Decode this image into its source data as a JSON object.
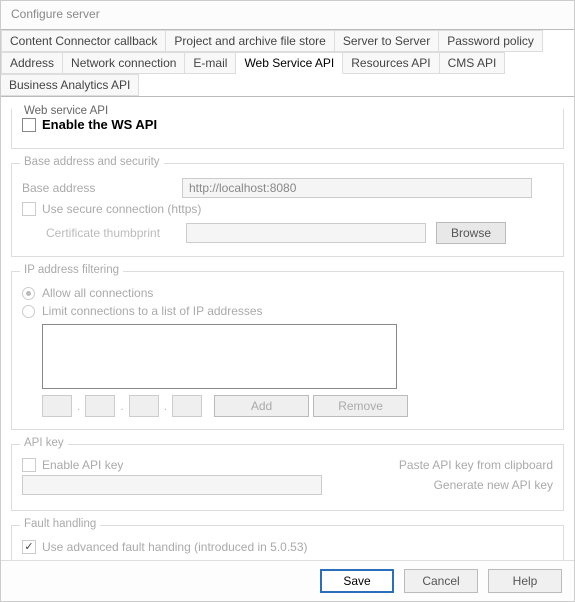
{
  "window_title": "Configure server",
  "tabs_row1": [
    "Content Connector callback",
    "Project and archive file store",
    "Server to Server",
    "Password policy"
  ],
  "tabs_row2": [
    "Address",
    "Network connection",
    "E-mail",
    "Web Service API",
    "Resources API",
    "CMS API",
    "Business Analytics API"
  ],
  "active_tab": "Web Service API",
  "groups": {
    "top_legend": "Web service API",
    "enable_ws_label": "Enable the WS API",
    "base": {
      "legend": "Base address and security",
      "base_address_label": "Base address",
      "base_address_value": "http://localhost:8080",
      "secure_conn_label": "Use secure connection (https)",
      "cert_label": "Certificate thumbprint",
      "browse_btn": "Browse"
    },
    "ipfilter": {
      "legend": "IP address filtering",
      "allow_all": "Allow all connections",
      "limit": "Limit connections to a list of IP addresses",
      "add_btn": "Add",
      "remove_btn": "Remove"
    },
    "apikey": {
      "legend": "API key",
      "enable_label": "Enable API key",
      "paste_link": "Paste API key from clipboard",
      "generate_link": "Generate new API key"
    },
    "fault": {
      "legend": "Fault handling",
      "advanced_label": "Use advanced fault handing (introduced in 5.0.53)"
    }
  },
  "footer": {
    "save": "Save",
    "cancel": "Cancel",
    "help": "Help"
  }
}
